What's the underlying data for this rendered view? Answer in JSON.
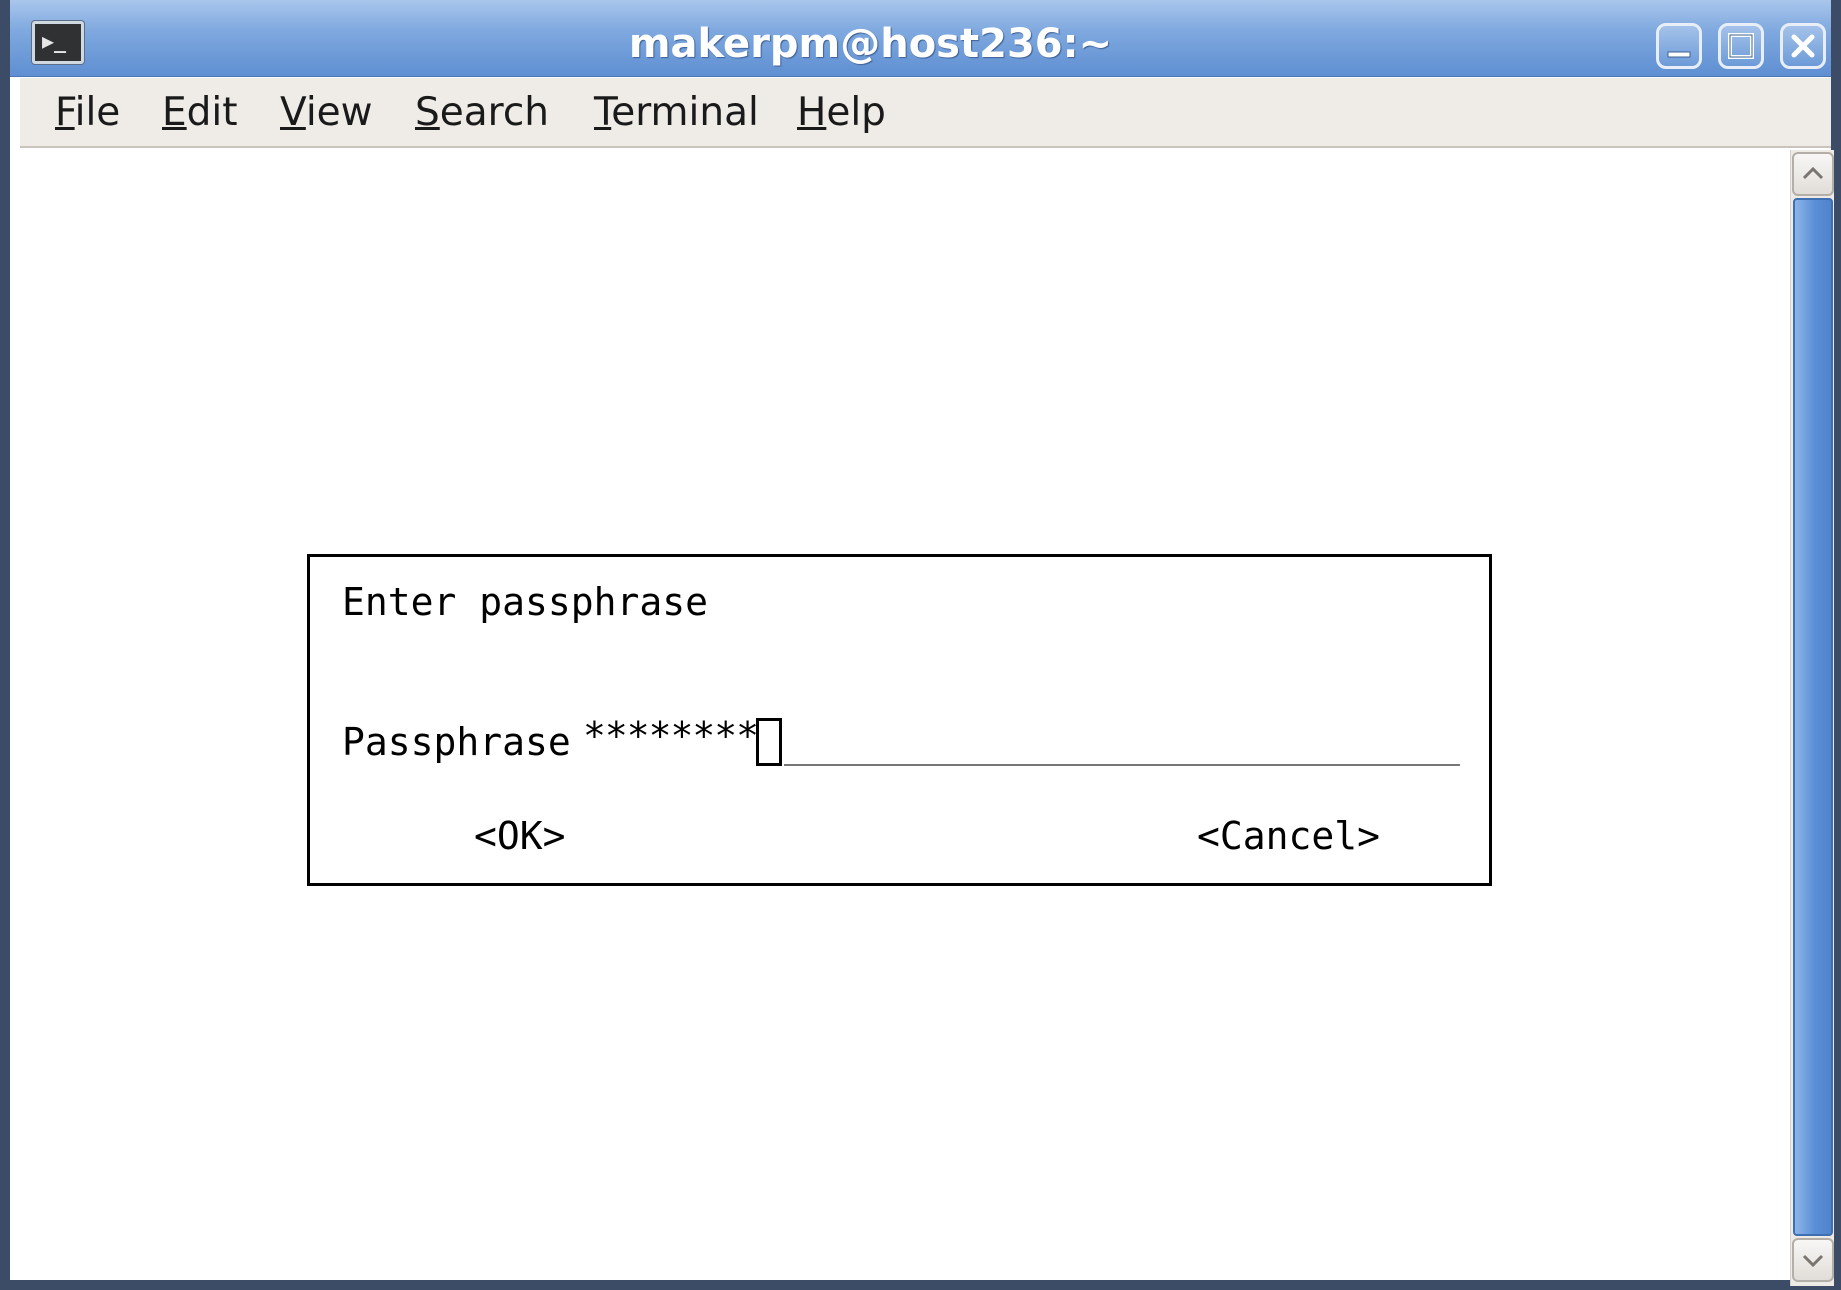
{
  "window": {
    "title": "makerpm@host236:~",
    "app_icon_glyph": "▶_"
  },
  "menubar": {
    "items": [
      {
        "mnemonic": "F",
        "rest": "ile"
      },
      {
        "mnemonic": "E",
        "rest": "dit"
      },
      {
        "mnemonic": "V",
        "rest": "iew"
      },
      {
        "mnemonic": "S",
        "rest": "earch"
      },
      {
        "mnemonic": "T",
        "rest": "erminal"
      },
      {
        "mnemonic": "H",
        "rest": "elp"
      }
    ]
  },
  "dialog": {
    "title": "Enter passphrase",
    "field_label": "Passphrase",
    "field_value": "********",
    "ok_label": "<OK>",
    "cancel_label": "<Cancel>"
  },
  "colors": {
    "titlebar": "#6f9bd8",
    "menubar_bg": "#efebe7",
    "scroll_thumb": "#5b8fd6",
    "terminal_bg": "#ffffff"
  },
  "icons": [
    "terminal-icon",
    "minimize-icon",
    "maximize-icon",
    "close-icon",
    "scroll-up-arrow-icon",
    "scroll-down-arrow-icon"
  ]
}
